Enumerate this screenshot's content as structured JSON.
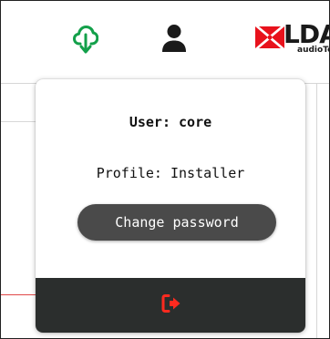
{
  "header": {
    "icons": [
      "cloud-upload-icon",
      "user-icon"
    ],
    "logo": {
      "text": "LDA",
      "subtext": "audioTech",
      "colors": {
        "mark": "#e8121c",
        "text": "#1a1a1a"
      }
    },
    "colors": {
      "cloud_icon": "#13a04a",
      "user_icon": "#1a1a1a"
    }
  },
  "user_menu": {
    "user_text": "User: core",
    "profile_text": "Profile: Installer",
    "change_password_label": "Change password",
    "logout_icon": "logout-icon",
    "colors": {
      "button_bg": "#4a4a4a",
      "footer_bg": "#2b2e2d",
      "logout_icon": "#ff2a1f"
    }
  }
}
